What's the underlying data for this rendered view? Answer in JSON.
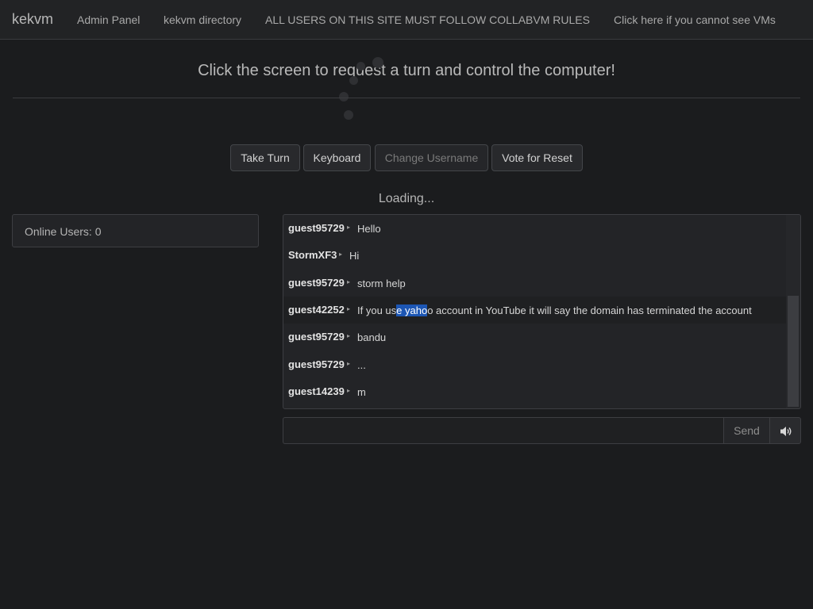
{
  "navbar": {
    "brand": "kekvm",
    "links": [
      "Admin Panel",
      "kekvm directory",
      "ALL USERS ON THIS SITE MUST FOLLOW COLLABVM RULES",
      "Click here if you cannot see VMs"
    ]
  },
  "main": {
    "headline": "Click the screen to request a turn and control the computer!",
    "loading_text": "Loading..."
  },
  "buttons": {
    "take_turn": "Take Turn",
    "keyboard": "Keyboard",
    "change_username": "Change Username",
    "vote_reset": "Vote for Reset"
  },
  "users_panel": {
    "online_label": "Online Users: 0"
  },
  "chat": {
    "messages": [
      {
        "user": "guest95729",
        "text": "Hello"
      },
      {
        "user": "StormXF3",
        "text": "Hi"
      },
      {
        "user": "guest95729",
        "text": "storm help"
      },
      {
        "user": "guest42252",
        "text_before": "If you us",
        "text_selected": "e yaho",
        "text_after": "o account in YouTube it will say the domain has terminated the account"
      },
      {
        "user": "guest95729",
        "text": "bandu"
      },
      {
        "user": "guest95729",
        "text": "..."
      },
      {
        "user": "guest14239",
        "text": "m"
      }
    ],
    "input_placeholder": "",
    "send_label": "Send"
  },
  "icons": {
    "sound": "speaker-icon",
    "message_separator": "triangle-right-icon"
  },
  "colors": {
    "background": "#1b1c1e",
    "selection": "#1c56b4"
  }
}
